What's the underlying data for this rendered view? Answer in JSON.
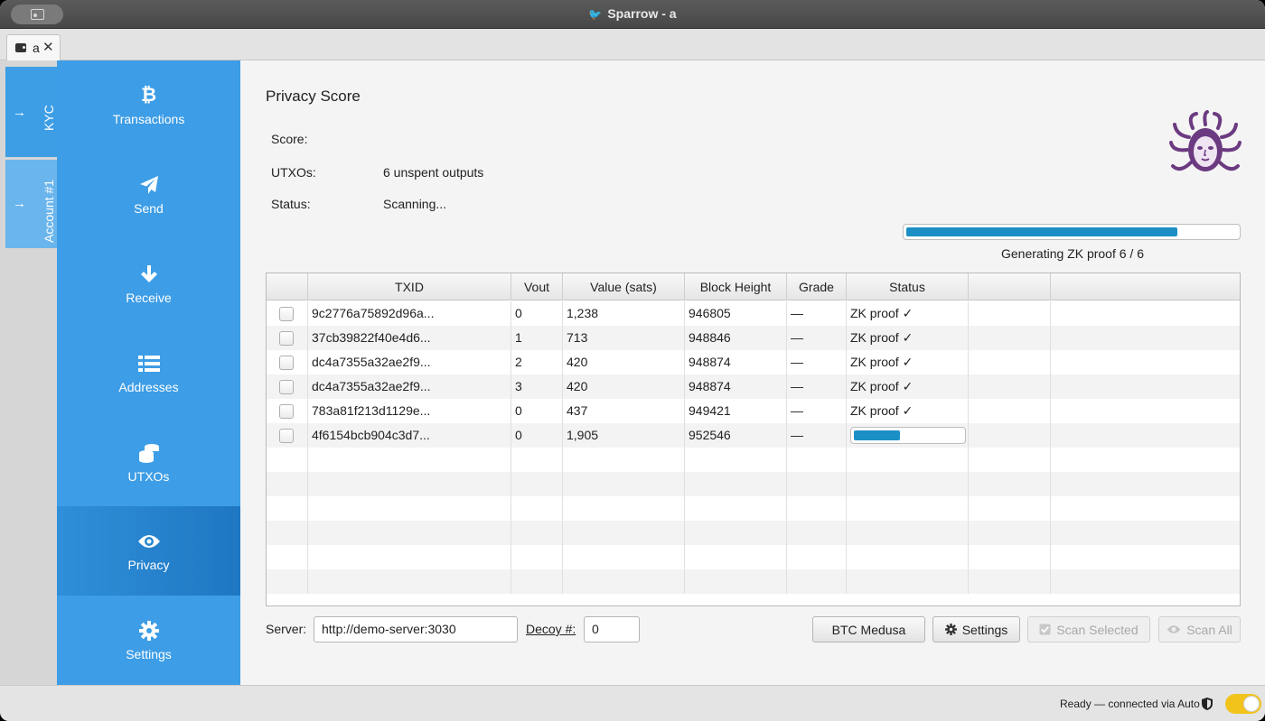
{
  "window": {
    "title": "Sparrow - a"
  },
  "tabs": [
    {
      "label": "a",
      "close_glyph": "✕"
    }
  ],
  "accounts": [
    {
      "label": "KYC",
      "icon": "arrow-right-icon"
    },
    {
      "label": "Account #1",
      "icon": "arrow-right-icon"
    }
  ],
  "sidebar": {
    "items": [
      {
        "label": "Transactions",
        "icon": "bitcoin-icon"
      },
      {
        "label": "Send",
        "icon": "paper-plane-icon"
      },
      {
        "label": "Receive",
        "icon": "arrow-down-icon"
      },
      {
        "label": "Addresses",
        "icon": "list-icon"
      },
      {
        "label": "UTXOs",
        "icon": "coins-icon"
      },
      {
        "label": "Privacy",
        "icon": "eye-icon",
        "active": true
      },
      {
        "label": "Settings",
        "icon": "gear-icon"
      }
    ]
  },
  "privacy": {
    "title": "Privacy Score",
    "score_label": "Score:",
    "score_value": "",
    "utxos_label": "UTXOs:",
    "utxos_value": "6 unspent outputs",
    "status_label": "Status:",
    "status_value": "Scanning...",
    "progress_fraction": 0.82,
    "progress_caption": "Generating ZK proof 6 / 6"
  },
  "table": {
    "columns": [
      "",
      "TXID",
      "Vout",
      "Value (sats)",
      "Block Height",
      "Grade",
      "Status",
      "",
      ""
    ],
    "rows": [
      {
        "txid": "9c2776a75892d96a...",
        "vout": "0",
        "value": "1,238",
        "height": "946805",
        "grade": "—",
        "status": "ZK proof ✓"
      },
      {
        "txid": "37cb39822f40e4d6...",
        "vout": "1",
        "value": "713",
        "height": "948846",
        "grade": "—",
        "status": "ZK proof ✓"
      },
      {
        "txid": "dc4a7355a32ae2f9...",
        "vout": "2",
        "value": "420",
        "height": "948874",
        "grade": "—",
        "status": "ZK proof ✓"
      },
      {
        "txid": "dc4a7355a32ae2f9...",
        "vout": "3",
        "value": "420",
        "height": "948874",
        "grade": "—",
        "status": "ZK proof ✓"
      },
      {
        "txid": "783a81f213d1129e...",
        "vout": "0",
        "value": "437",
        "height": "949421",
        "grade": "—",
        "status": "ZK proof ✓"
      },
      {
        "txid": "4f6154bcb904c3d7...",
        "vout": "0",
        "value": "1,905",
        "height": "952546",
        "grade": "—",
        "status": "",
        "progress_fraction": 0.42
      }
    ]
  },
  "controls": {
    "server_label": "Server:",
    "server_value": "http://demo-server:3030",
    "decoy_label": "Decoy #:",
    "decoy_value": "0",
    "btc_medusa": "BTC Medusa",
    "settings": "Settings",
    "scan_selected": "Scan Selected",
    "scan_all": "Scan All"
  },
  "statusbar": {
    "text": "Ready — connected via Auto"
  },
  "colors": {
    "sidebar": "#3d9de6",
    "accent": "#1b8fc6",
    "toggle": "#f2c31b"
  }
}
